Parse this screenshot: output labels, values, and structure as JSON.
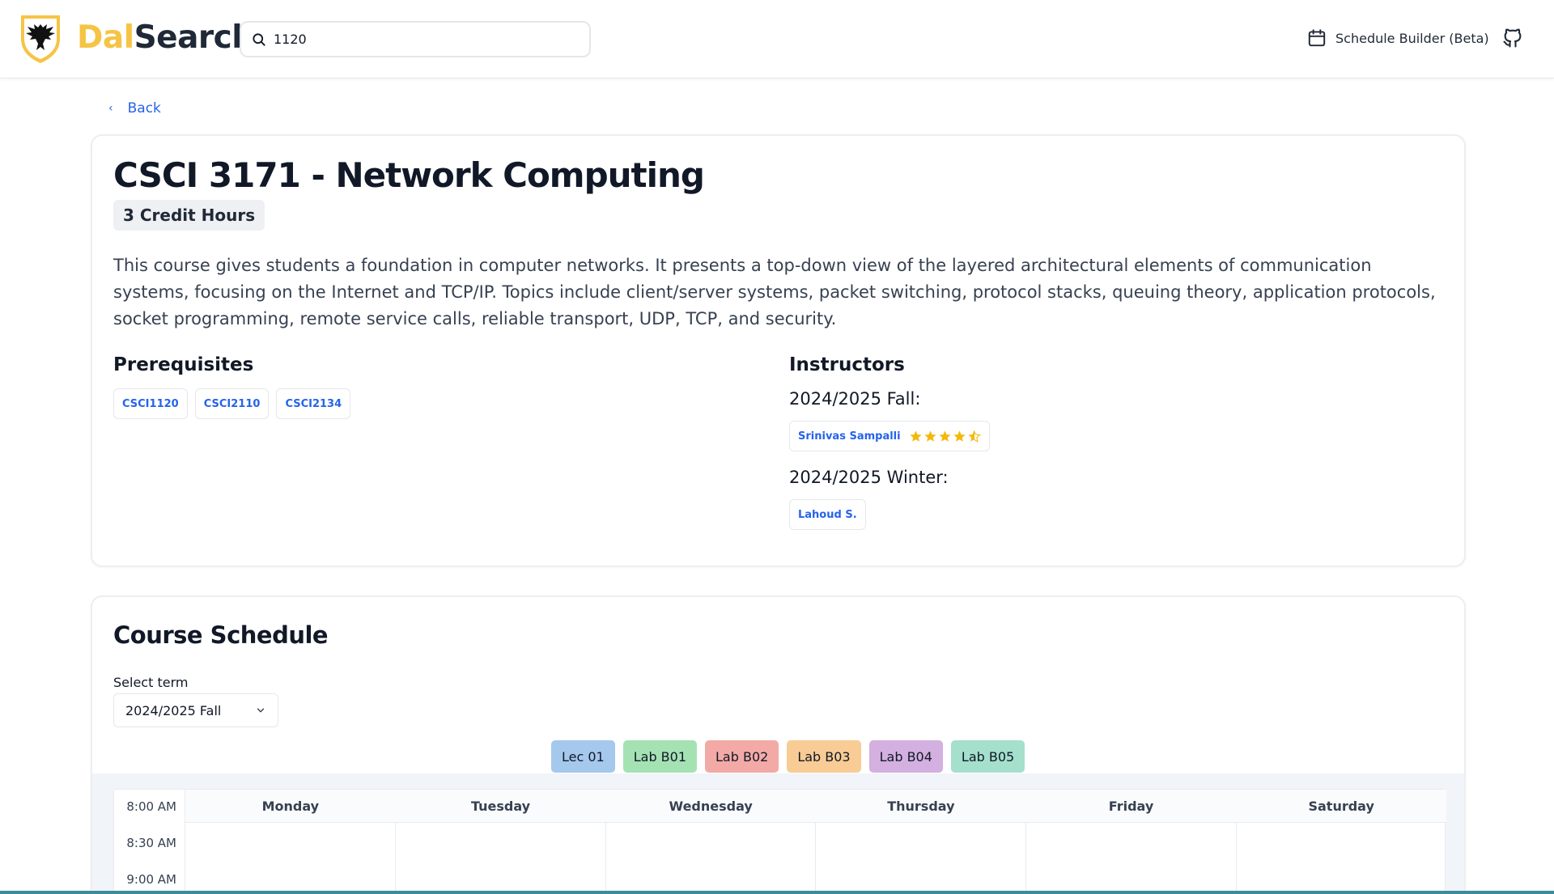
{
  "header": {
    "brand_part1": "Dal",
    "brand_part2": "Search",
    "search_value": "1120",
    "schedule_builder_label": "Schedule Builder (Beta)"
  },
  "back_label": "Back",
  "course": {
    "title": "CSCI 3171 - Network Computing",
    "credits": "3 Credit Hours",
    "description": "This course gives students a foundation in computer networks. It presents a top-down view of the layered architectural elements of communication systems, focusing on the Internet and TCP/IP. Topics include client/server systems, packet switching, protocol stacks, queuing theory, application protocols, socket programming, remote service calls, reliable transport, UDP, TCP, and security.",
    "prerequisites_heading": "Prerequisites",
    "prerequisites": [
      "CSCI1120",
      "CSCI2110",
      "CSCI2134"
    ],
    "instructors_heading": "Instructors",
    "instructor_terms": [
      {
        "term": "2024/2025 Fall:",
        "instructor": "Srinivas Sampalli",
        "rating": 4.5
      },
      {
        "term": "2024/2025 Winter:",
        "instructor": "Lahoud S."
      }
    ]
  },
  "schedule": {
    "title": "Course Schedule",
    "select_label": "Select term",
    "selected_term": "2024/2025 Fall",
    "legend": [
      {
        "label": "Lec 01",
        "color": "#a5c8ed"
      },
      {
        "label": "Lab B01",
        "color": "#a4e2b4"
      },
      {
        "label": "Lab B02",
        "color": "#f3aaa6"
      },
      {
        "label": "Lab B03",
        "color": "#f8cc94"
      },
      {
        "label": "Lab B04",
        "color": "#d3b0df"
      },
      {
        "label": "Lab B05",
        "color": "#a4e0cc"
      }
    ],
    "days": [
      "Monday",
      "Tuesday",
      "Wednesday",
      "Thursday",
      "Friday",
      "Saturday"
    ],
    "times": [
      "8:00 AM",
      "8:30 AM",
      "9:00 AM"
    ]
  },
  "colors": {
    "brand_yellow": "#f6c445",
    "link_blue": "#2563eb",
    "star": "#f5b80a"
  }
}
